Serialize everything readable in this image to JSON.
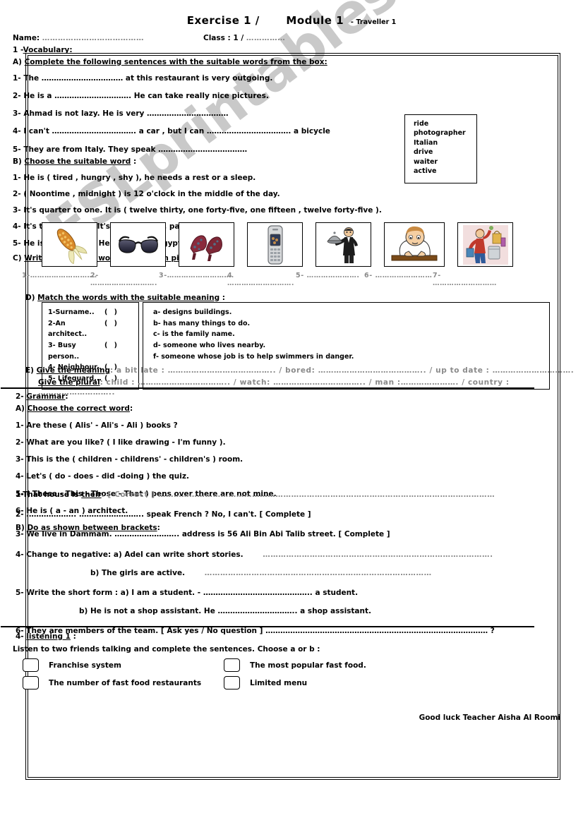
{
  "watermark": "ESLprintables.com",
  "header": {
    "title_a": "Exercise 1  /",
    "title_b": "Module 1",
    "dash": "-",
    "subtitle": "Traveller 1",
    "name_label": "Name:",
    "name_dots": "…………………………………",
    "class_label": "Class   : 1  /",
    "class_dots": "……………"
  },
  "section1": {
    "heading": "1 -",
    "heading_u": "Vocabulary",
    "heading_colon": ":",
    "partA": {
      "label": "A)",
      "title": "Complete the following sentences with the suitable words from the box:",
      "items": [
        "1-  The  ……………………………  at this restaurant is very outgoing.",
        "2- He is a ………………………….   He can take really nice pictures.",
        "3- Ahmad is not lazy.  He is very ……………………………",
        "4-  I can't ……………………………. a car , but I can ……………………………. a bicycle",
        "5- They are  from Italy.  They speak ………………………………"
      ],
      "wordbox": [
        "ride",
        "photographer",
        "Italian",
        "drive",
        "waiter",
        "active"
      ]
    },
    "partB": {
      "label": "B)",
      "title": "Choose the suitable word",
      "colon": ":",
      "items": [
        "1-   He is ( tired , hungry , shy ), he needs a rest or a sleep.",
        "2- ( Noontime , midnight ) is 12 o'clock in the middle  of the day.",
        "3- It's quarter to one.  It is ( twelve thirty, one forty-five, one fifteen ,  twelve forty-five ).",
        "4- It's three fifteen.  It's quarter ( to ,  past ) three.",
        "5- He is from Egypt.  He is ( Egypt,  Egyptian )."
      ]
    },
    "partC": {
      "label": "C)",
      "title": "Write the correct word under each picture",
      "colon": ":",
      "pictures": [
        {
          "icon": "corn-cob-icon",
          "alt": "corn"
        },
        {
          "icon": "sunglasses-icon",
          "alt": "sunglasses"
        },
        {
          "icon": "high-heel-shoes-icon",
          "alt": "shoes"
        },
        {
          "icon": "mobile-phone-icon",
          "alt": "mobile phone"
        },
        {
          "icon": "waiter-icon",
          "alt": "waiter"
        },
        {
          "icon": "tired-man-at-desk-icon",
          "alt": "tired man"
        },
        {
          "icon": "busy-shopper-icon",
          "alt": "busy shopper"
        }
      ],
      "labels": [
        "1-……………………….",
        "2- ……………………….",
        "3-……………………….",
        "4 ……………………….",
        "5- ………………….",
        "6- ……………………",
        "7- ………………………"
      ]
    },
    "partD": {
      "label": "D)",
      "title": "Match the words with the suitable meaning",
      "colon": ":",
      "left": [
        {
          "text": "1-Surname..",
          "paren": "(    )"
        },
        {
          "text": "2-An architect..",
          "paren": "(    )"
        },
        {
          "text": "3- Busy person..",
          "paren": "(    )"
        },
        {
          "text": "4- Neighbour..",
          "paren": "(    )"
        },
        {
          "text": "5- Lifeguard...",
          "paren": "(    )"
        }
      ],
      "right": [
        "a- designs buildings.",
        "b- has many things to do.",
        "c- is the family name.",
        "d- someone who lives nearby.",
        "f- someone whose job is to help swimmers in danger."
      ]
    },
    "partE": {
      "label": "E)",
      "title1": "Give the meaning",
      "line1": ":  a bit late : ………………………………….. / bored: ………………………………….. / up to date  : ………………………….",
      "title2": "Give the plural",
      "line2": ":    child : …………………………….. / watch: …………………………….. / man :…………………. / country : ……………………….."
    }
  },
  "section2": {
    "heading": "2-",
    "heading_u": "Grammar",
    "heading_colon": ":",
    "partA": {
      "label": "A)",
      "title": "Choose the correct word",
      "colon": ":",
      "items": [
        "1- Are these ( Alis' - Ali's - Ali ) books ?",
        "2- What are you like?   ( I like drawing - I'm funny ).",
        "3- This is the ( children - childrens' - children's ) room.",
        "4- Let's ( do - does - did -doing ) the quiz.",
        "5- ( These - This - Those - That ) pens over there are not mine.",
        "6- He is ( a - an ) architect."
      ]
    },
    "partB": {
      "label": "B)",
      "title": "Do as shown between brackets",
      "colon": ":",
      "q1_a": "1-That house is ",
      "q1_u": "their",
      "q1_b": ".        [ Correct ] …………………………………………………………………………………………………………………",
      "q2": "2- ……………….. …………………….. speak French ?  No, I can't.     [ Complete ]",
      "q3": "3- We live in Dammam.  ……………………..        address is 56 Ali Bin Abi Talib street.            [ Complete ]",
      "q4_main": "4-  Change to negative:      a)   Adel can write short stories.",
      "q4_dots1": "…………………………………………………………………………….",
      "q4_b": "b)   The girls are active.",
      "q4_dots2": "……………………………………………………………………………",
      "q5_main": "5- Write the short form : a) I am a student.         - ……………………………………..  a student.",
      "q5_b": "b) He is not a shop assistant.    He …………………………..    a shop assistant.",
      "q6": "6- They are members of the team. [ Ask yes / No question ] ……………………………………………………………………………… ?"
    }
  },
  "section4": {
    "heading": "4-",
    "heading_u": "listening 1",
    "heading_colon": " :",
    "instruction": "Listen to two friends talking and complete the sentences. Choose a  or  b :",
    "options": [
      {
        "left": "Franchise system",
        "right": "The most popular fast food."
      },
      {
        "left": "The number of fast food restaurants",
        "right": "Limited menu"
      }
    ],
    "footer": "Good luck    Teacher Aisha Al Roomi"
  }
}
